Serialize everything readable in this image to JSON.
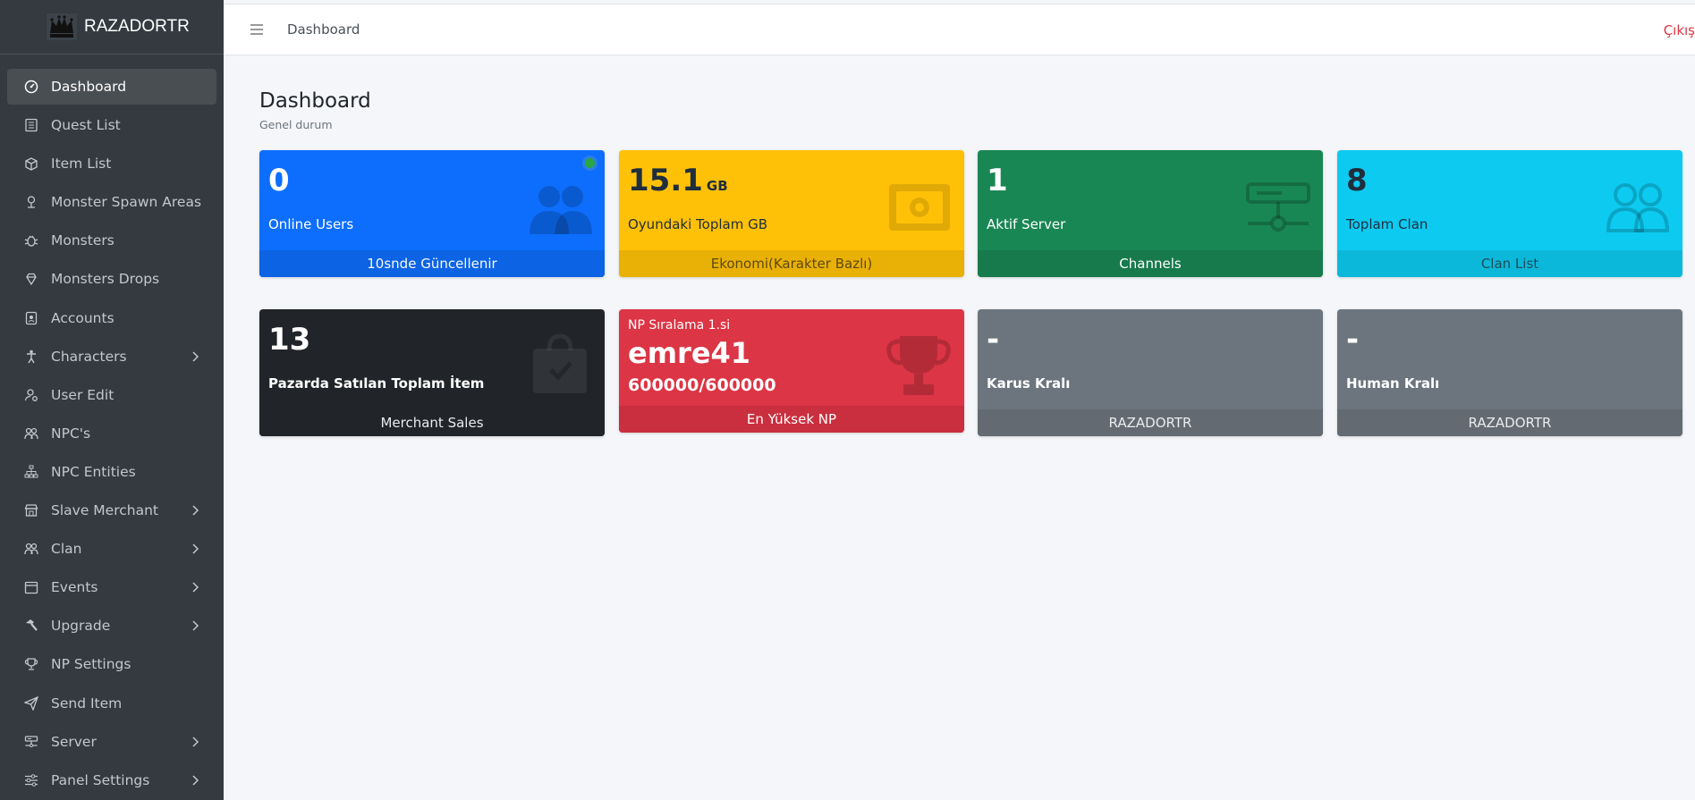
{
  "brand": {
    "name": "RAZADORTR",
    "logo_icon": "crown-icon"
  },
  "sidebar": {
    "items": [
      {
        "label": "Dashboard",
        "icon": "dashboard-gauge-icon",
        "active": true,
        "has_submenu": false
      },
      {
        "label": "Quest List",
        "icon": "list-icon",
        "active": false,
        "has_submenu": false
      },
      {
        "label": "Item List",
        "icon": "box-icon",
        "active": false,
        "has_submenu": false
      },
      {
        "label": "Monster Spawn Areas",
        "icon": "map-pin-icon",
        "active": false,
        "has_submenu": false
      },
      {
        "label": "Monsters",
        "icon": "bug-icon",
        "active": false,
        "has_submenu": false
      },
      {
        "label": "Monsters Drops",
        "icon": "gem-icon",
        "active": false,
        "has_submenu": false
      },
      {
        "label": "Accounts",
        "icon": "id-card-icon",
        "active": false,
        "has_submenu": false
      },
      {
        "label": "Characters",
        "icon": "person-icon",
        "active": false,
        "has_submenu": true
      },
      {
        "label": "User Edit",
        "icon": "user-gear-icon",
        "active": false,
        "has_submenu": false
      },
      {
        "label": "NPC's",
        "icon": "people-icon",
        "active": false,
        "has_submenu": false
      },
      {
        "label": "NPC Entities",
        "icon": "hierarchy-icon",
        "active": false,
        "has_submenu": false
      },
      {
        "label": "Slave Merchant",
        "icon": "shop-icon",
        "active": false,
        "has_submenu": true
      },
      {
        "label": "Clan",
        "icon": "people-icon",
        "active": false,
        "has_submenu": true
      },
      {
        "label": "Events",
        "icon": "calendar-icon",
        "active": false,
        "has_submenu": true
      },
      {
        "label": "Upgrade",
        "icon": "hammer-icon",
        "active": false,
        "has_submenu": true
      },
      {
        "label": "NP Settings",
        "icon": "trophy-icon",
        "active": false,
        "has_submenu": false
      },
      {
        "label": "Send Item",
        "icon": "send-icon",
        "active": false,
        "has_submenu": false
      },
      {
        "label": "Server",
        "icon": "server-icon",
        "active": false,
        "has_submenu": true
      },
      {
        "label": "Panel Settings",
        "icon": "sliders-icon",
        "active": false,
        "has_submenu": true
      }
    ]
  },
  "topbar": {
    "menu_icon": "hamburger-icon",
    "link": "Dashboard",
    "logout": "Çıkış"
  },
  "page": {
    "title": "Dashboard",
    "subtitle": "Genel durum"
  },
  "cards_row1": [
    {
      "value": "0",
      "unit": "",
      "label": "Online Users",
      "footer": "10snde Güncellenir",
      "icon": "people-fill-icon",
      "color": "#0d6efd",
      "status_dot": true
    },
    {
      "value": "15.1",
      "unit": "GB",
      "label": "Oyundaki Toplam GB",
      "footer": "Ekonomi(Karakter Bazlı)",
      "icon": "cash-icon",
      "color": "#ffc107"
    },
    {
      "value": "1",
      "unit": "",
      "label": "Aktif Server",
      "footer": "Channels",
      "icon": "server-icon",
      "color": "#198754"
    },
    {
      "value": "8",
      "unit": "",
      "label": "Toplam Clan",
      "footer": "Clan List",
      "icon": "people-icon",
      "color": "#0dcaf0"
    }
  ],
  "cards_row2": [
    {
      "value": "13",
      "label": "Pazarda Satılan Toplam İtem",
      "footer": "Merchant Sales",
      "icon": "shopping-bag-icon",
      "color": "#212529"
    },
    {
      "top_label": "NP Sıralama 1.si",
      "name": "emre41",
      "score": "600000/600000",
      "footer": "En Yüksek NP",
      "icon": "trophy-icon",
      "color": "#dc3545"
    },
    {
      "value": "-",
      "label": "Karus Kralı",
      "footer": "RAZADORTR",
      "color": "#6c757d"
    },
    {
      "value": "-",
      "label": "Human Kralı",
      "footer": "RAZADORTR",
      "color": "#6c757d"
    }
  ]
}
